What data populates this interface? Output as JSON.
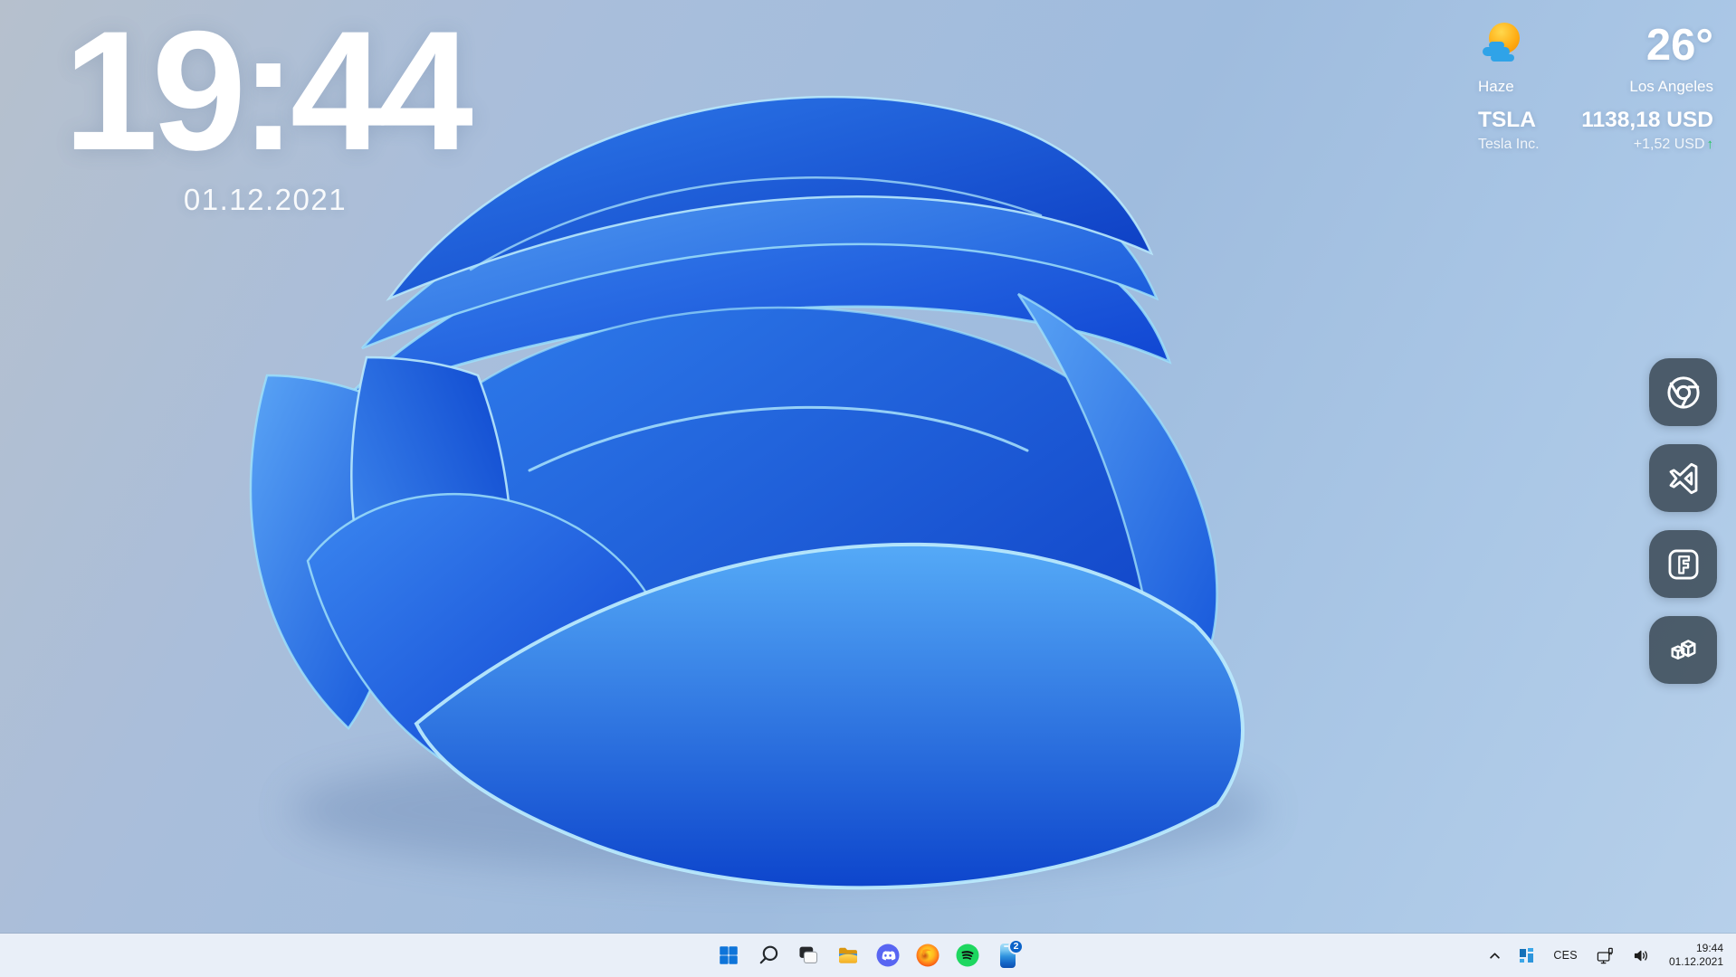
{
  "wallpaper": {
    "name": "windows-11-bloom",
    "bloom_blue": "#1a5ae0",
    "bloom_edge": "#9ddff9",
    "background_top_left": "#b6c0cd",
    "background_bottom_right": "#b7d0ea"
  },
  "clock_widget": {
    "time": "19:44",
    "date": "01.12.2021"
  },
  "weather_widget": {
    "temperature": "26°",
    "condition": "Haze",
    "city": "Los Angeles",
    "icon": "sun-with-haze"
  },
  "stock_widget": {
    "ticker": "TSLA",
    "company": "Tesla Inc.",
    "price": "1138,18 USD",
    "change": "+1,52 USD",
    "change_arrow": "↑",
    "direction": "up",
    "change_color": "#1fc65b"
  },
  "dock": {
    "background": "rgba(58,72,83,0.85)",
    "items": [
      {
        "name": "chrome"
      },
      {
        "name": "visual-studio"
      },
      {
        "name": "fortnite"
      },
      {
        "name": "minecraft-blocks"
      }
    ]
  },
  "taskbar": {
    "background": "#e9eff8",
    "items": [
      {
        "name": "start"
      },
      {
        "name": "search"
      },
      {
        "name": "task-view"
      },
      {
        "name": "file-explorer"
      },
      {
        "name": "discord"
      },
      {
        "name": "firefox"
      },
      {
        "name": "spotify"
      },
      {
        "name": "phone-link",
        "badge": "2"
      }
    ],
    "phone_badge": "2",
    "tray": {
      "icons": [
        "hidden-icons-chevron",
        "tray-app-tiles",
        "network-ethernet",
        "volume"
      ],
      "language": "CES",
      "time": "19:44",
      "date": "01.12.2021"
    }
  }
}
